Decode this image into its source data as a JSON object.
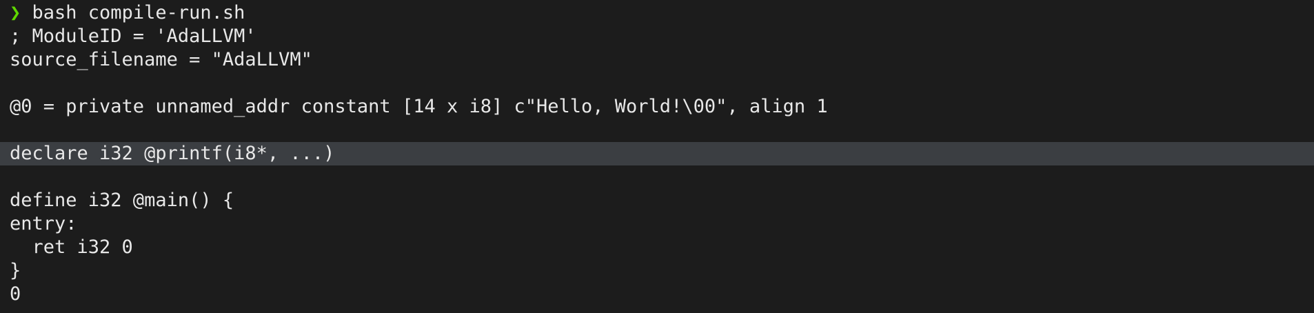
{
  "terminal": {
    "prompt": {
      "symbol": "❯",
      "command": " bash compile-run.sh"
    },
    "output": [
      "; ModuleID = 'AdaLLVM'",
      "source_filename = \"AdaLLVM\"",
      "",
      "@0 = private unnamed_addr constant [14 x i8] c\"Hello, World!\\00\", align 1",
      "",
      "declare i32 @printf(i8*, ...)",
      "",
      "define i32 @main() {",
      "entry:",
      "  ret i32 0",
      "}",
      "0"
    ]
  },
  "colors": {
    "background": "#1c1c1c",
    "text": "#e8e8e8",
    "prompt": "#5fd700",
    "highlight": "#3b3e42"
  }
}
